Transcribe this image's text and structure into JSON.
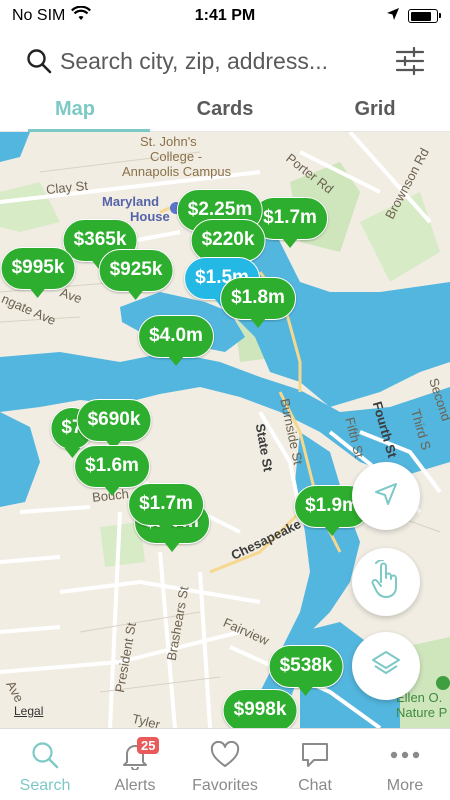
{
  "status": {
    "carrier": "No SIM",
    "time": "1:41 PM",
    "battery_level": 0.8
  },
  "search": {
    "placeholder": "Search city, zip, address..."
  },
  "tabs": [
    {
      "label": "Map",
      "active": true
    },
    {
      "label": "Cards",
      "active": false
    },
    {
      "label": "Grid",
      "active": false
    }
  ],
  "map": {
    "labels": {
      "st_johns_1": "St. John's",
      "st_johns_2": "College -",
      "st_johns_3": "Annapolis Campus",
      "maryland_1": "Maryland",
      "maryland_2": "House",
      "clay_st": "Clay St",
      "porter_rd": "Porter Rd",
      "brownson_rd": "Brownson Rd",
      "state_st": "State St",
      "burnside_st": "Burnside St",
      "fifth_st": "Fifth St",
      "fourth_st": "Fourth St",
      "third_st": "Third S",
      "second_st": "Second",
      "chesapeake": "Chesapeake",
      "bouch": "Bouch",
      "brashears_st": "Brashears St",
      "president_st": "President St",
      "fairview": "Fairview",
      "tyler": "Tyler",
      "ave_1": "Ave",
      "ave_2": "Ave",
      "gate_ave": "ngate Ave",
      "ellen_1": "Ellen O.",
      "ellen_2": "Nature P",
      "legal": "Legal"
    },
    "pins": [
      {
        "price": "$1.7m"
      },
      {
        "price": "$2.25m"
      },
      {
        "price": "$365k"
      },
      {
        "price": "$220k"
      },
      {
        "price": "$995k"
      },
      {
        "price": "$925k"
      },
      {
        "price": "$1.5m"
      },
      {
        "price": "$1.8m"
      },
      {
        "price": "$4.0m"
      },
      {
        "price": "$7"
      },
      {
        "price": "$690k"
      },
      {
        "price": "$1.6m"
      },
      {
        "price": "$1.7m"
      },
      {
        "price": "$1.7m"
      },
      {
        "price": "$1.9m"
      },
      {
        "price": "$538k"
      },
      {
        "price": "$998k"
      }
    ]
  },
  "fabs": {
    "locate": "location-arrow-icon",
    "draw": "hand-draw-icon",
    "layers": "layers-icon"
  },
  "nav": [
    {
      "label": "Search",
      "icon": "search-icon",
      "active": true
    },
    {
      "label": "Alerts",
      "icon": "bell-icon",
      "badge": "25"
    },
    {
      "label": "Favorites",
      "icon": "heart-icon"
    },
    {
      "label": "Chat",
      "icon": "chat-icon"
    },
    {
      "label": "More",
      "icon": "more-icon"
    }
  ],
  "colors": {
    "accent": "#7cc9c6",
    "pin_green": "#2eae2e",
    "pin_selected": "#24b9e4",
    "water": "#53b6df",
    "badge_red": "#e95a5a"
  }
}
